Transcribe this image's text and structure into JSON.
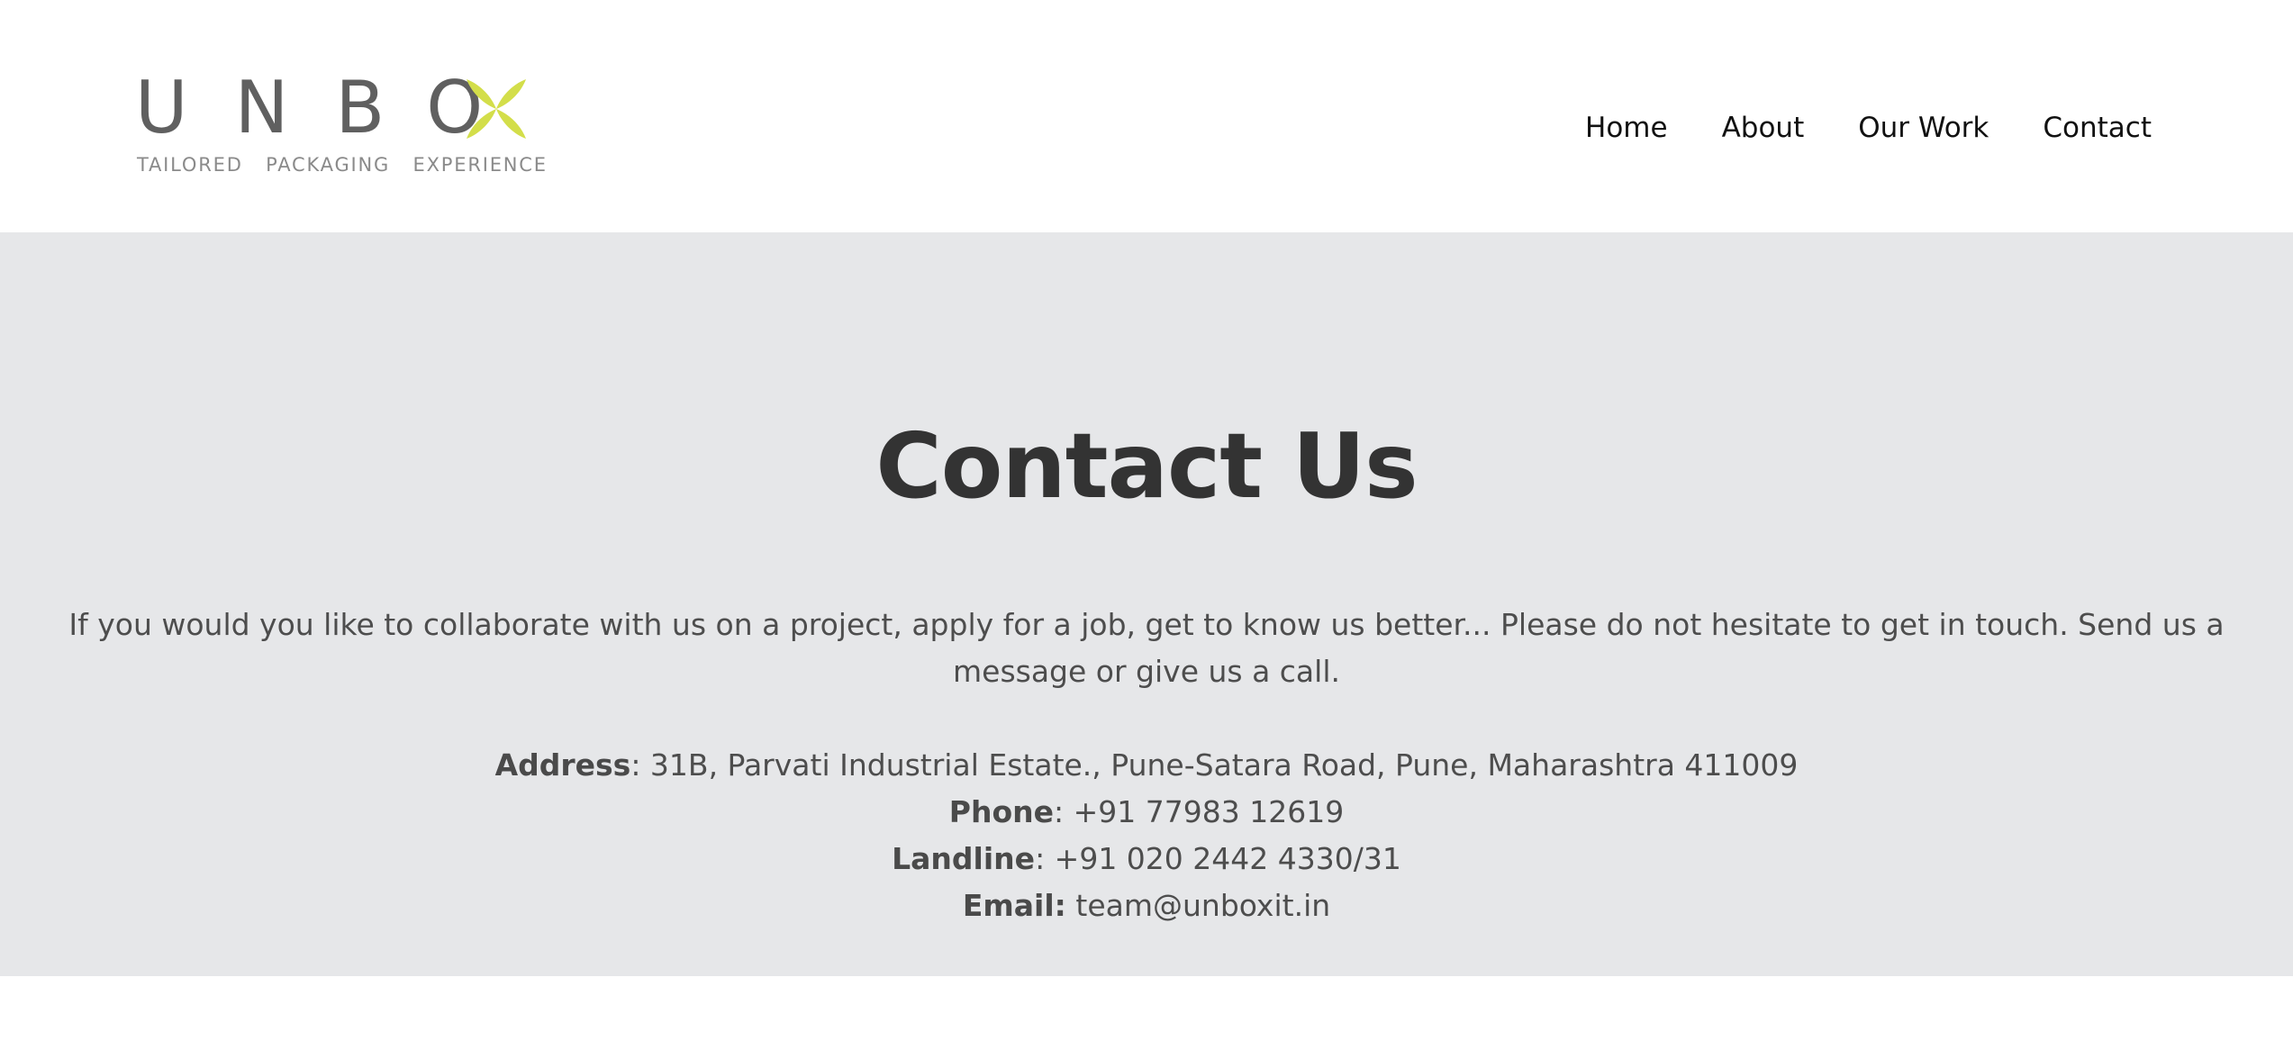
{
  "brand": {
    "letters": [
      "U",
      "N",
      "B",
      "O"
    ],
    "tagline": "TAILORED   PACKAGING   EXPERIENCE",
    "x_icon": "four-petal-x-icon",
    "text_color": "#606060",
    "accent_color": "#d3de4a"
  },
  "nav": {
    "items": [
      {
        "label": "Home"
      },
      {
        "label": "About"
      },
      {
        "label": "Our Work"
      },
      {
        "label": "Contact"
      }
    ]
  },
  "hero": {
    "background": "#e6e7e9",
    "title": "Contact Us",
    "intro": "If you would you like to collaborate with us on a project, apply for a job, get to know us better... Please do not hesitate to get in touch. Send us a message or give us a call."
  },
  "contact": {
    "address_label": "Address",
    "address_value": ": 31B, Parvati Industrial Estate., Pune-Satara Road, Pune, Maharashtra 411009",
    "phone_label": "Phone",
    "phone_value": ": +91 77983 12619",
    "landline_label": "Landline",
    "landline_value": ": +91 020 2442 4330/31",
    "email_label": "Email:",
    "email_value": "team@unboxit.in"
  }
}
